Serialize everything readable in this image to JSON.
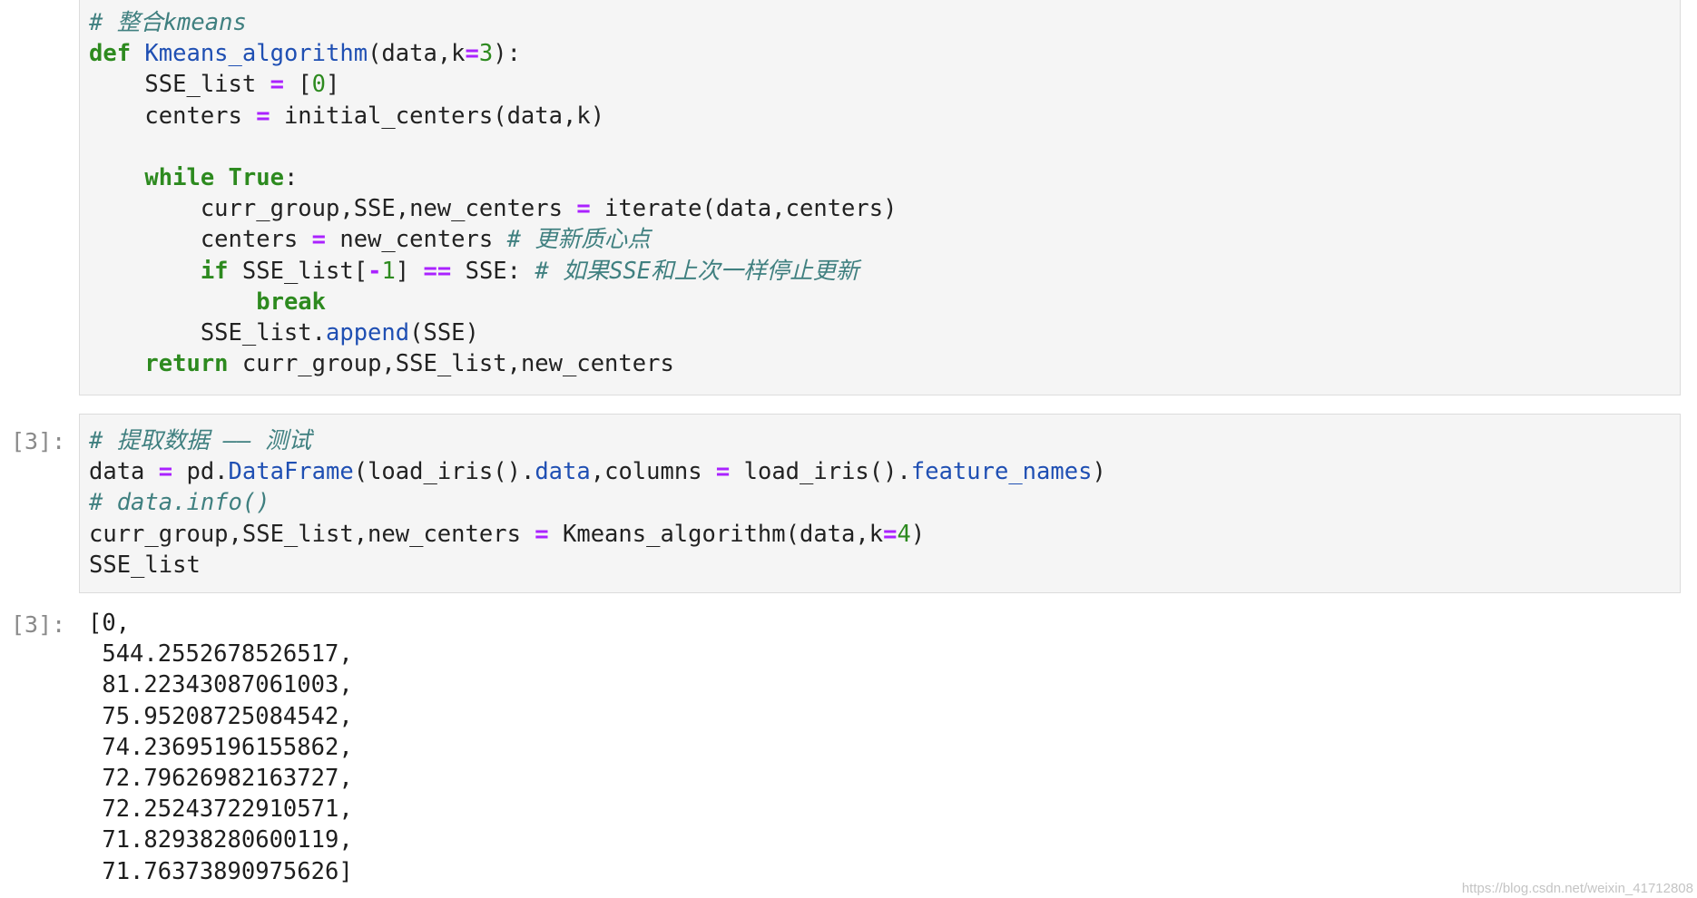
{
  "cells": [
    {
      "id": "cell-kmeans",
      "prompt": "",
      "top": 0,
      "lines": [
        [
          {
            "t": "comment",
            "v": "# 整合kmeans"
          }
        ],
        [
          {
            "t": "keyword",
            "v": "def"
          },
          {
            "t": "plain",
            "v": " "
          },
          {
            "t": "funcname",
            "v": "Kmeans_algorithm"
          },
          {
            "t": "plain",
            "v": "(data,k"
          },
          {
            "t": "operator",
            "v": "="
          },
          {
            "t": "number",
            "v": "3"
          },
          {
            "t": "plain",
            "v": "):"
          }
        ],
        [
          {
            "t": "plain",
            "v": "    SSE_list "
          },
          {
            "t": "operator",
            "v": "="
          },
          {
            "t": "plain",
            "v": " ["
          },
          {
            "t": "number",
            "v": "0"
          },
          {
            "t": "plain",
            "v": "]"
          }
        ],
        [
          {
            "t": "plain",
            "v": "    centers "
          },
          {
            "t": "operator",
            "v": "="
          },
          {
            "t": "plain",
            "v": " initial_centers(data,k)"
          }
        ],
        [
          {
            "t": "plain",
            "v": ""
          }
        ],
        [
          {
            "t": "plain",
            "v": "    "
          },
          {
            "t": "keyword",
            "v": "while"
          },
          {
            "t": "plain",
            "v": " "
          },
          {
            "t": "keyword",
            "v": "True"
          },
          {
            "t": "plain",
            "v": ":"
          }
        ],
        [
          {
            "t": "plain",
            "v": "        curr_group,SSE,new_centers "
          },
          {
            "t": "operator",
            "v": "="
          },
          {
            "t": "plain",
            "v": " iterate(data,centers)"
          }
        ],
        [
          {
            "t": "plain",
            "v": "        centers "
          },
          {
            "t": "operator",
            "v": "="
          },
          {
            "t": "plain",
            "v": " new_centers "
          },
          {
            "t": "comment",
            "v": "# 更新质心点"
          }
        ],
        [
          {
            "t": "plain",
            "v": "        "
          },
          {
            "t": "keyword",
            "v": "if"
          },
          {
            "t": "plain",
            "v": " SSE_list["
          },
          {
            "t": "operator",
            "v": "-"
          },
          {
            "t": "number",
            "v": "1"
          },
          {
            "t": "plain",
            "v": "] "
          },
          {
            "t": "operator",
            "v": "=="
          },
          {
            "t": "plain",
            "v": " SSE: "
          },
          {
            "t": "comment",
            "v": "# 如果SSE和上次一样停止更新"
          }
        ],
        [
          {
            "t": "plain",
            "v": "            "
          },
          {
            "t": "keyword",
            "v": "break"
          }
        ],
        [
          {
            "t": "plain",
            "v": "        SSE_list"
          },
          {
            "t": "plain",
            "v": "."
          },
          {
            "t": "builtin",
            "v": "append"
          },
          {
            "t": "plain",
            "v": "(SSE)"
          }
        ],
        [
          {
            "t": "plain",
            "v": "    "
          },
          {
            "t": "keyword",
            "v": "return"
          },
          {
            "t": "plain",
            "v": " curr_group,SSE_list,new_centers"
          }
        ]
      ]
    },
    {
      "id": "cell-test",
      "prompt": "[3]:",
      "lines": [
        [
          {
            "t": "comment",
            "v": "# 提取数据 —— 测试"
          }
        ],
        [
          {
            "t": "plain",
            "v": "data "
          },
          {
            "t": "operator",
            "v": "="
          },
          {
            "t": "plain",
            "v": " pd."
          },
          {
            "t": "builtin",
            "v": "DataFrame"
          },
          {
            "t": "plain",
            "v": "(load_iris()."
          },
          {
            "t": "builtin",
            "v": "data"
          },
          {
            "t": "plain",
            "v": ",columns "
          },
          {
            "t": "operator",
            "v": "="
          },
          {
            "t": "plain",
            "v": " load_iris()."
          },
          {
            "t": "builtin",
            "v": "feature_names"
          },
          {
            "t": "plain",
            "v": ")"
          }
        ],
        [
          {
            "t": "comment",
            "v": "# data.info()"
          }
        ],
        [
          {
            "t": "plain",
            "v": "curr_group,SSE_list,new_centers "
          },
          {
            "t": "operator",
            "v": "="
          },
          {
            "t": "plain",
            "v": " Kmeans_algorithm(data,k"
          },
          {
            "t": "operator",
            "v": "="
          },
          {
            "t": "number",
            "v": "4"
          },
          {
            "t": "plain",
            "v": ")"
          }
        ],
        [
          {
            "t": "plain",
            "v": "SSE_list"
          }
        ]
      ]
    }
  ],
  "output": {
    "prompt": "[3]:",
    "lines": [
      "[0,",
      " 544.2552678526517,",
      " 81.22343087061003,",
      " 75.95208725084542,",
      " 74.23695196155862,",
      " 72.79626982163727,",
      " 72.25243722910571,",
      " 71.82938280600119,",
      " 71.76373890975626]"
    ]
  },
  "watermark": "https://blog.csdn.net/weixin_41712808"
}
